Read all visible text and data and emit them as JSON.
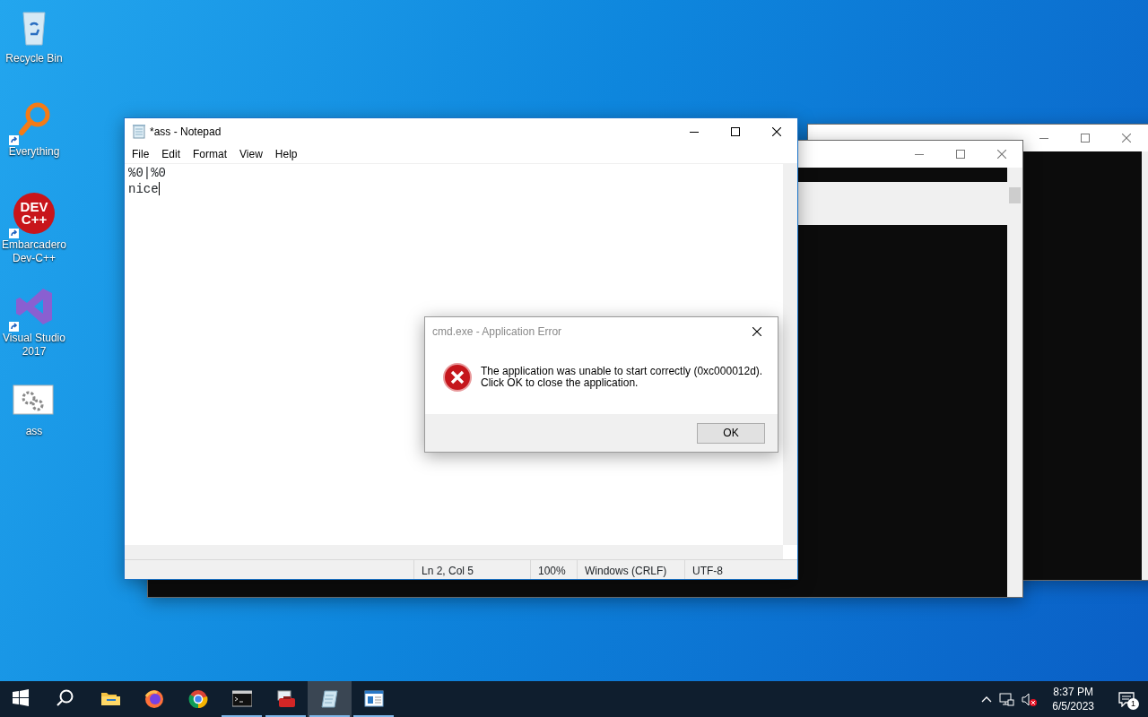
{
  "desktop_icons": [
    {
      "label": "Recycle Bin",
      "kind": "recycle",
      "shortcut": false
    },
    {
      "label": "Everything",
      "kind": "search",
      "shortcut": true
    },
    {
      "label": "Embarcadero Dev-C++",
      "kind": "devcpp",
      "shortcut": true,
      "logo": [
        "DEV",
        "C++"
      ]
    },
    {
      "label": "Visual Studio 2017",
      "kind": "vs",
      "shortcut": true
    },
    {
      "label": "ass",
      "kind": "batch",
      "shortcut": false
    }
  ],
  "notepad": {
    "title": "*ass - Notepad",
    "menu": [
      "File",
      "Edit",
      "Format",
      "View",
      "Help"
    ],
    "lines": [
      "%0|%0",
      "nice"
    ],
    "status_bar": [
      "Ln 2, Col 5",
      "100%",
      "Windows (CRLF)",
      "UTF-8"
    ]
  },
  "dialog": {
    "title": "cmd.exe - Application Error",
    "message": [
      "The application was unable to start correctly (0xc000012d).",
      "Click OK to close the application."
    ],
    "button": "OK"
  },
  "taskbar": {
    "apps": [
      {
        "kind": "start",
        "running": false,
        "selected": false
      },
      {
        "kind": "search",
        "running": false,
        "selected": false
      },
      {
        "kind": "explorer",
        "running": false,
        "selected": false
      },
      {
        "kind": "firefox",
        "running": false,
        "selected": false
      },
      {
        "kind": "chrome",
        "running": false,
        "selected": false
      },
      {
        "kind": "terminal",
        "running": true,
        "selected": false
      },
      {
        "kind": "toolbox",
        "running": true,
        "selected": false
      },
      {
        "kind": "notepad",
        "running": true,
        "selected": true
      },
      {
        "kind": "window",
        "running": true,
        "selected": false
      }
    ],
    "time": "8:37 PM",
    "date": "6/5/2023",
    "notifications": "1"
  }
}
